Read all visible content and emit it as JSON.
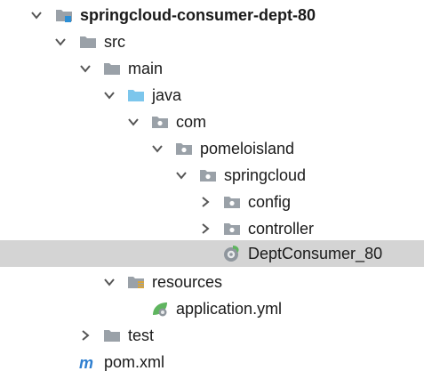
{
  "tree": {
    "root": {
      "label": "springcloud-consumer-dept-80",
      "expanded": true,
      "icon": "module-folder-icon"
    },
    "src": {
      "label": "src",
      "expanded": true,
      "icon": "folder-icon"
    },
    "main": {
      "label": "main",
      "expanded": true,
      "icon": "folder-icon"
    },
    "java": {
      "label": "java",
      "expanded": true,
      "icon": "source-root-folder-icon"
    },
    "com": {
      "label": "com",
      "expanded": true,
      "icon": "package-icon"
    },
    "pomeloisland": {
      "label": "pomeloisland",
      "expanded": true,
      "icon": "package-icon"
    },
    "springcloud": {
      "label": "springcloud",
      "expanded": true,
      "icon": "package-icon"
    },
    "config": {
      "label": "config",
      "expanded": false,
      "icon": "package-icon"
    },
    "controller": {
      "label": "controller",
      "expanded": false,
      "icon": "package-icon"
    },
    "dept_consumer": {
      "label": "DeptConsumer_80",
      "selected": true,
      "icon": "spring-boot-class-icon"
    },
    "resources": {
      "label": "resources",
      "expanded": true,
      "icon": "resources-folder-icon"
    },
    "application_yml": {
      "label": "application.yml",
      "icon": "spring-config-file-icon"
    },
    "test": {
      "label": "test",
      "expanded": false,
      "icon": "folder-icon"
    },
    "pom": {
      "label": "pom.xml",
      "icon": "maven-icon"
    }
  },
  "colors": {
    "selection": "#d4d4d4",
    "folder": "#9aa1a8",
    "source_folder": "#7cc6ec",
    "resources_stripe": "#d9a53b",
    "spring_green": "#5fb55f",
    "maven_blue": "#2f7fd0",
    "module_marker": "#2d8fd5"
  }
}
